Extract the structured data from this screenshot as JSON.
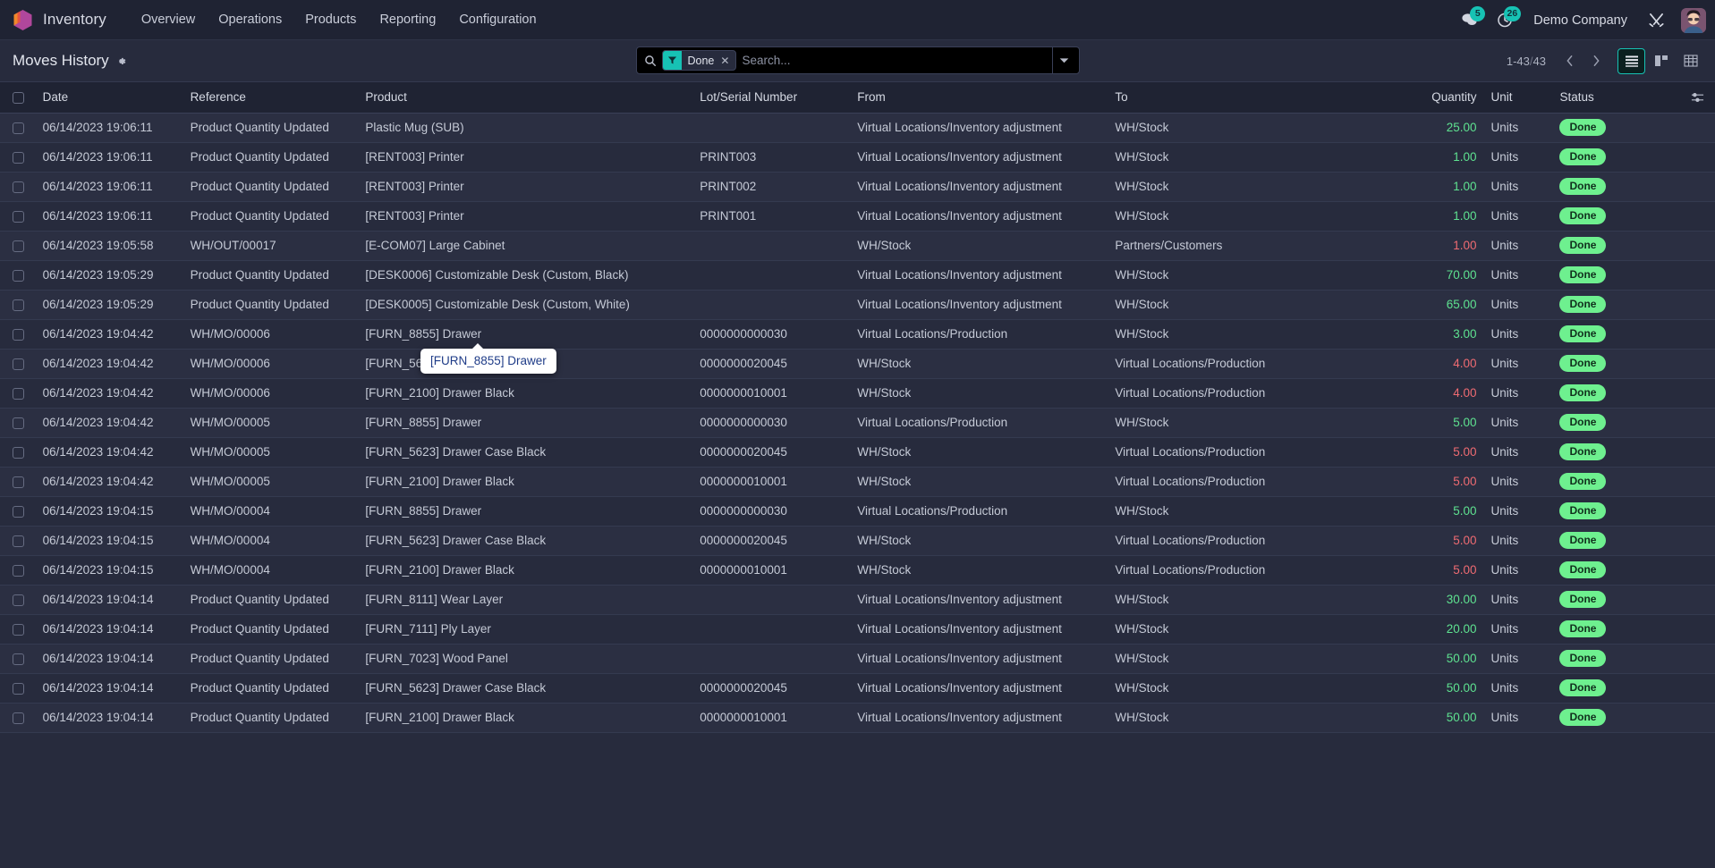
{
  "navbar": {
    "logo_icon": "odoo-cube-logo",
    "app_name": "Inventory",
    "menu": [
      {
        "label": "Overview"
      },
      {
        "label": "Operations"
      },
      {
        "label": "Products"
      },
      {
        "label": "Reporting"
      },
      {
        "label": "Configuration"
      }
    ],
    "messages_icon": "chat-bubble-icon",
    "messages_count": "5",
    "activities_icon": "clock-icon",
    "activities_count": "26",
    "company": "Demo Company",
    "debug_icon": "tools-icon",
    "avatar_icon": "user-avatar"
  },
  "control_panel": {
    "title": "Moves History",
    "gear_icon": "gear-icon",
    "search": {
      "icon": "search-icon",
      "placeholder": "Search...",
      "value": "",
      "facet": {
        "icon": "filter-icon",
        "label": "Done",
        "remove_icon": "close-icon"
      },
      "dropdown_icon": "chevron-down-icon"
    },
    "pager": {
      "range": "1-43",
      "separator": "/",
      "total": "43",
      "prev_icon": "chevron-left-icon",
      "next_icon": "chevron-right-icon"
    },
    "views": [
      {
        "name": "list",
        "icon": "list-view-icon",
        "active": true
      },
      {
        "name": "kanban",
        "icon": "kanban-view-icon",
        "active": false
      },
      {
        "name": "pivot",
        "icon": "pivot-view-icon",
        "active": false
      }
    ]
  },
  "table": {
    "columns": [
      "Date",
      "Reference",
      "Product",
      "Lot/Serial Number",
      "From",
      "To",
      "Quantity",
      "Unit",
      "Status"
    ],
    "options_icon": "sliders-icon",
    "rows": [
      {
        "date": "06/14/2023 19:06:11",
        "reference": "Product Quantity Updated",
        "product": "Plastic Mug (SUB)",
        "lot": "",
        "from": "Virtual Locations/Inventory adjustment",
        "to": "WH/Stock",
        "quantity": "25.00",
        "qty_sign": "pos",
        "unit": "Units",
        "status": "Done"
      },
      {
        "date": "06/14/2023 19:06:11",
        "reference": "Product Quantity Updated",
        "product": "[RENT003] Printer",
        "lot": "PRINT003",
        "from": "Virtual Locations/Inventory adjustment",
        "to": "WH/Stock",
        "quantity": "1.00",
        "qty_sign": "pos",
        "unit": "Units",
        "status": "Done"
      },
      {
        "date": "06/14/2023 19:06:11",
        "reference": "Product Quantity Updated",
        "product": "[RENT003] Printer",
        "lot": "PRINT002",
        "from": "Virtual Locations/Inventory adjustment",
        "to": "WH/Stock",
        "quantity": "1.00",
        "qty_sign": "pos",
        "unit": "Units",
        "status": "Done"
      },
      {
        "date": "06/14/2023 19:06:11",
        "reference": "Product Quantity Updated",
        "product": "[RENT003] Printer",
        "lot": "PRINT001",
        "from": "Virtual Locations/Inventory adjustment",
        "to": "WH/Stock",
        "quantity": "1.00",
        "qty_sign": "pos",
        "unit": "Units",
        "status": "Done"
      },
      {
        "date": "06/14/2023 19:05:58",
        "reference": "WH/OUT/00017",
        "product": "[E-COM07] Large Cabinet",
        "lot": "",
        "from": "WH/Stock",
        "to": "Partners/Customers",
        "quantity": "1.00",
        "qty_sign": "neg",
        "unit": "Units",
        "status": "Done"
      },
      {
        "date": "06/14/2023 19:05:29",
        "reference": "Product Quantity Updated",
        "product": "[DESK0006] Customizable Desk (Custom, Black)",
        "lot": "",
        "from": "Virtual Locations/Inventory adjustment",
        "to": "WH/Stock",
        "quantity": "70.00",
        "qty_sign": "pos",
        "unit": "Units",
        "status": "Done"
      },
      {
        "date": "06/14/2023 19:05:29",
        "reference": "Product Quantity Updated",
        "product": "[DESK0005] Customizable Desk (Custom, White)",
        "lot": "",
        "from": "Virtual Locations/Inventory adjustment",
        "to": "WH/Stock",
        "quantity": "65.00",
        "qty_sign": "pos",
        "unit": "Units",
        "status": "Done"
      },
      {
        "date": "06/14/2023 19:04:42",
        "reference": "WH/MO/00006",
        "product": "[FURN_8855] Drawer",
        "lot": "0000000000030",
        "from": "Virtual Locations/Production",
        "to": "WH/Stock",
        "quantity": "3.00",
        "qty_sign": "pos",
        "unit": "Units",
        "status": "Done"
      },
      {
        "date": "06/14/2023 19:04:42",
        "reference": "WH/MO/00006",
        "product": "[FURN_5623] Drawer Case Black",
        "lot": "0000000020045",
        "from": "WH/Stock",
        "to": "Virtual Locations/Production",
        "quantity": "4.00",
        "qty_sign": "neg",
        "unit": "Units",
        "status": "Done"
      },
      {
        "date": "06/14/2023 19:04:42",
        "reference": "WH/MO/00006",
        "product": "[FURN_2100] Drawer Black",
        "lot": "0000000010001",
        "from": "WH/Stock",
        "to": "Virtual Locations/Production",
        "quantity": "4.00",
        "qty_sign": "neg",
        "unit": "Units",
        "status": "Done"
      },
      {
        "date": "06/14/2023 19:04:42",
        "reference": "WH/MO/00005",
        "product": "[FURN_8855] Drawer",
        "lot": "0000000000030",
        "from": "Virtual Locations/Production",
        "to": "WH/Stock",
        "quantity": "5.00",
        "qty_sign": "pos",
        "unit": "Units",
        "status": "Done"
      },
      {
        "date": "06/14/2023 19:04:42",
        "reference": "WH/MO/00005",
        "product": "[FURN_5623] Drawer Case Black",
        "lot": "0000000020045",
        "from": "WH/Stock",
        "to": "Virtual Locations/Production",
        "quantity": "5.00",
        "qty_sign": "neg",
        "unit": "Units",
        "status": "Done"
      },
      {
        "date": "06/14/2023 19:04:42",
        "reference": "WH/MO/00005",
        "product": "[FURN_2100] Drawer Black",
        "lot": "0000000010001",
        "from": "WH/Stock",
        "to": "Virtual Locations/Production",
        "quantity": "5.00",
        "qty_sign": "neg",
        "unit": "Units",
        "status": "Done"
      },
      {
        "date": "06/14/2023 19:04:15",
        "reference": "WH/MO/00004",
        "product": "[FURN_8855] Drawer",
        "lot": "0000000000030",
        "from": "Virtual Locations/Production",
        "to": "WH/Stock",
        "quantity": "5.00",
        "qty_sign": "pos",
        "unit": "Units",
        "status": "Done"
      },
      {
        "date": "06/14/2023 19:04:15",
        "reference": "WH/MO/00004",
        "product": "[FURN_5623] Drawer Case Black",
        "lot": "0000000020045",
        "from": "WH/Stock",
        "to": "Virtual Locations/Production",
        "quantity": "5.00",
        "qty_sign": "neg",
        "unit": "Units",
        "status": "Done"
      },
      {
        "date": "06/14/2023 19:04:15",
        "reference": "WH/MO/00004",
        "product": "[FURN_2100] Drawer Black",
        "lot": "0000000010001",
        "from": "WH/Stock",
        "to": "Virtual Locations/Production",
        "quantity": "5.00",
        "qty_sign": "neg",
        "unit": "Units",
        "status": "Done"
      },
      {
        "date": "06/14/2023 19:04:14",
        "reference": "Product Quantity Updated",
        "product": "[FURN_8111] Wear Layer",
        "lot": "",
        "from": "Virtual Locations/Inventory adjustment",
        "to": "WH/Stock",
        "quantity": "30.00",
        "qty_sign": "pos",
        "unit": "Units",
        "status": "Done"
      },
      {
        "date": "06/14/2023 19:04:14",
        "reference": "Product Quantity Updated",
        "product": "[FURN_7111] Ply Layer",
        "lot": "",
        "from": "Virtual Locations/Inventory adjustment",
        "to": "WH/Stock",
        "quantity": "20.00",
        "qty_sign": "pos",
        "unit": "Units",
        "status": "Done"
      },
      {
        "date": "06/14/2023 19:04:14",
        "reference": "Product Quantity Updated",
        "product": "[FURN_7023] Wood Panel",
        "lot": "",
        "from": "Virtual Locations/Inventory adjustment",
        "to": "WH/Stock",
        "quantity": "50.00",
        "qty_sign": "pos",
        "unit": "Units",
        "status": "Done"
      },
      {
        "date": "06/14/2023 19:04:14",
        "reference": "Product Quantity Updated",
        "product": "[FURN_5623] Drawer Case Black",
        "lot": "0000000020045",
        "from": "Virtual Locations/Inventory adjustment",
        "to": "WH/Stock",
        "quantity": "50.00",
        "qty_sign": "pos",
        "unit": "Units",
        "status": "Done"
      },
      {
        "date": "06/14/2023 19:04:14",
        "reference": "Product Quantity Updated",
        "product": "[FURN_2100] Drawer Black",
        "lot": "0000000010001",
        "from": "Virtual Locations/Inventory adjustment",
        "to": "WH/Stock",
        "quantity": "50.00",
        "qty_sign": "pos",
        "unit": "Units",
        "status": "Done"
      }
    ]
  },
  "tooltip": {
    "text": "[FURN_8855] Drawer"
  }
}
